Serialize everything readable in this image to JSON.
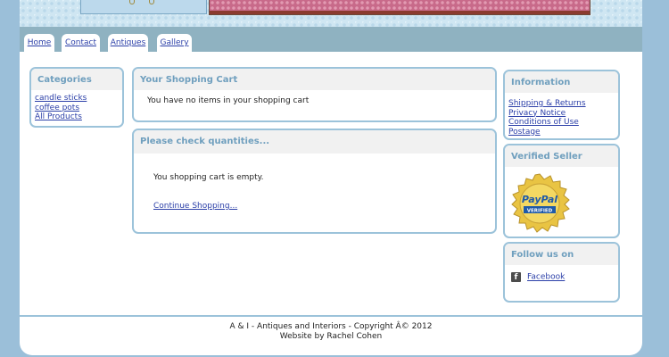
{
  "nav": {
    "tabs": [
      {
        "label": "Home"
      },
      {
        "label": "Contact"
      },
      {
        "label": "Antiques"
      },
      {
        "label": "Gallery"
      }
    ]
  },
  "categories": {
    "title": "Categories",
    "items": [
      "candle sticks",
      "coffee pots",
      "All Products "
    ]
  },
  "cart": {
    "title": "Your Shopping Cart",
    "message": "You have no items in your shopping cart"
  },
  "check": {
    "title": "Please check quantities...",
    "message": "You shopping cart is empty.",
    "continue_link": "Continue Shopping..."
  },
  "information": {
    "title": "Information",
    "items": [
      "Shipping & Returns ",
      "Privacy Notice ",
      "Conditions of Use ",
      "Postage "
    ]
  },
  "verified": {
    "title": "Verified Seller",
    "badge_text_top": "PayPal",
    "badge_text_bottom": "VERIFIED"
  },
  "follow": {
    "title": "Follow us on",
    "facebook_label": "Facebook",
    "facebook_icon": "facebook-icon"
  },
  "footer": {
    "line1": "A & I - Antiques and Interiors - Copyright Â© 2012",
    "line2": "Website by Rachel Cohen"
  },
  "colors": {
    "background": "#9bbfd9",
    "nav": "#8fb2c1",
    "box_border": "#9cc3da",
    "heading": "#6f9fbe",
    "link": "#2b3fa8",
    "badge_gold": "#e9c443",
    "badge_blue": "#1f5aa8"
  }
}
